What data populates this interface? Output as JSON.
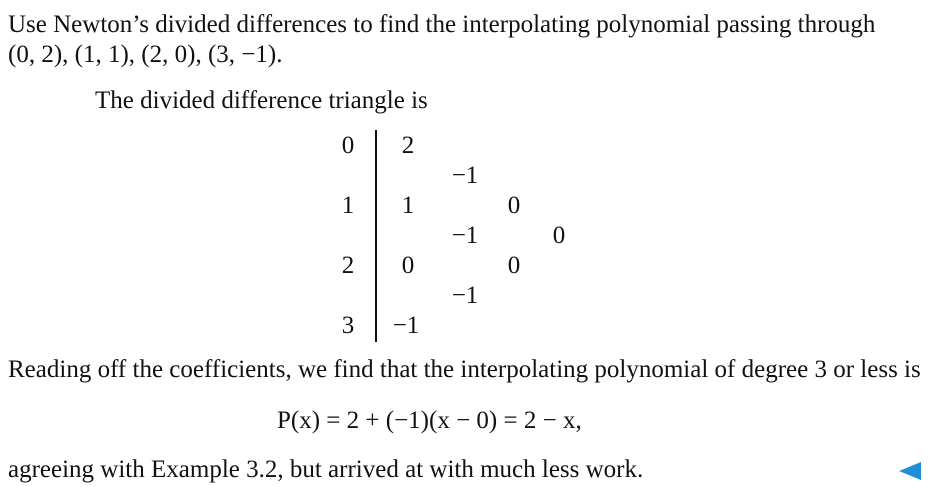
{
  "problem": {
    "line1": "Use Newton’s divided differences to find the interpolating polynomial passing through",
    "line2": "(0, 2), (1, 1), (2, 0), (3, −1)."
  },
  "intro": "The divided difference triangle is",
  "table": {
    "x": [
      "0",
      "1",
      "2",
      "3"
    ],
    "f": [
      "2",
      "1",
      "0",
      "−1"
    ],
    "first": [
      "−1",
      "−1",
      "−1"
    ],
    "second": [
      "0",
      "0"
    ],
    "third": [
      "0"
    ]
  },
  "conclusion": "Reading off the coefficients, we find that the interpolating polynomial of degree 3 or less is",
  "equation": "P(x) = 2 + (−1)(x − 0) = 2 − x,",
  "closing": "agreeing with Example 3.2, but arrived at with much less work.",
  "end_marker": "triangle-left-icon",
  "accent_color": "#1e8fd6"
}
